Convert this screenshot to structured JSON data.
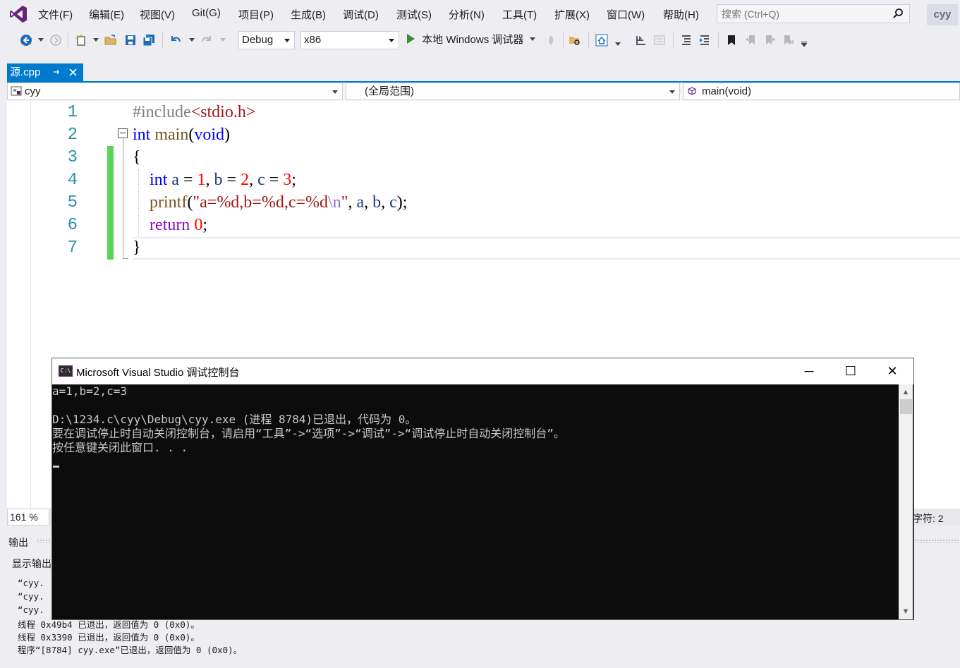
{
  "menubar": {
    "items": [
      "文件(F)",
      "编辑(E)",
      "视图(V)",
      "Git(G)",
      "项目(P)",
      "生成(B)",
      "调试(D)",
      "测试(S)",
      "分析(N)",
      "工具(T)",
      "扩展(X)",
      "窗口(W)",
      "帮助(H)"
    ],
    "search_placeholder": "搜索 (Ctrl+Q)",
    "user": "cyy"
  },
  "toolbar": {
    "configuration": "Debug",
    "platform": "x86",
    "debugger_label": "本地 Windows 调试器"
  },
  "tab": {
    "filename": "源.cpp",
    "pin_icon": "pin-icon",
    "close_icon": "close-icon"
  },
  "navbar": {
    "project": "cyy",
    "scope": "(全局范围)",
    "member": "main(void)"
  },
  "editor": {
    "line_numbers": [
      "1",
      "2",
      "3",
      "4",
      "5",
      "6",
      "7"
    ],
    "zoom": "161 %",
    "char_status": "字符: 2"
  },
  "colors": {
    "accent": "#007acc",
    "keyword": "#0000ff",
    "number": "#ff0000",
    "string": "#a31515",
    "change_bar": "#57d557",
    "console_bg": "#0c0c0c"
  },
  "output": {
    "title": "输出",
    "show_label": "显示输出",
    "lines": [
      "“cyy.",
      "“cyy.",
      "“cyy.",
      "线程 0x49b4 已退出，返回值为 0 (0x0)。",
      "线程 0x3390 已退出，返回值为 0 (0x0)。",
      "程序“[8784] cyy.exe”已退出，返回值为 0 (0x0)。"
    ]
  },
  "console": {
    "title": "Microsoft Visual Studio 调试控制台",
    "icon_text": "C:\\",
    "lines": [
      "a=1,b=2,c=3",
      "",
      "D:\\1234.c\\cyy\\Debug\\cyy.exe (进程 8784)已退出，代码为 0。",
      "要在调试停止时自动关闭控制台，请启用“工具”->“选项”->“调试”->“调试停止时自动关闭控制台”。",
      "按任意键关闭此窗口. . ."
    ],
    "minimize": "─",
    "maximize": "☐",
    "close": "✕"
  }
}
